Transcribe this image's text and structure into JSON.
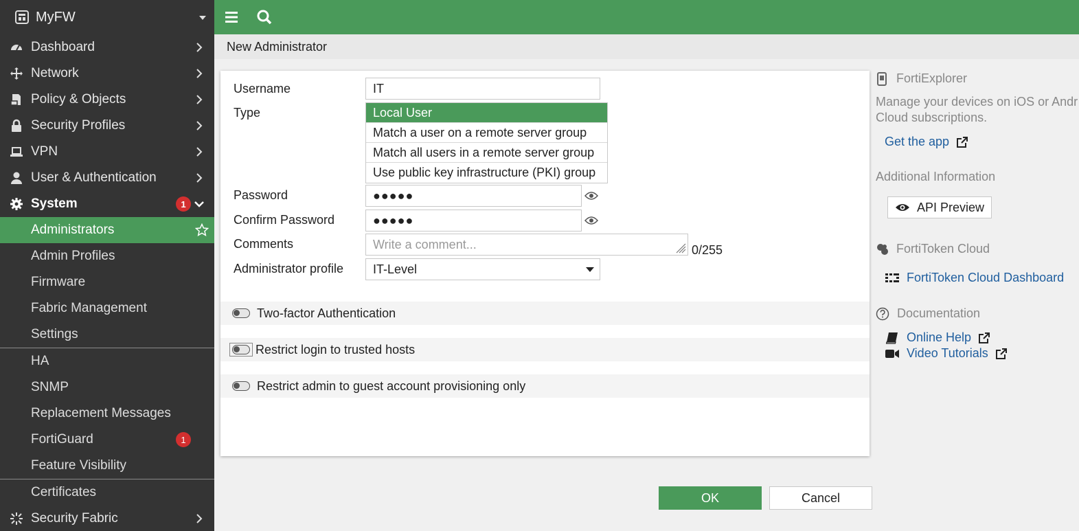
{
  "app": {
    "device_name": "MyFW"
  },
  "sidebar": {
    "items": [
      {
        "label": "Dashboard",
        "icon": "dashboard-icon"
      },
      {
        "label": "Network",
        "icon": "network-icon"
      },
      {
        "label": "Policy & Objects",
        "icon": "policy-icon"
      },
      {
        "label": "Security Profiles",
        "icon": "lock-icon"
      },
      {
        "label": "VPN",
        "icon": "laptop-icon"
      },
      {
        "label": "User & Authentication",
        "icon": "user-icon"
      },
      {
        "label": "System",
        "icon": "gear-icon",
        "badge": "1"
      }
    ],
    "system_sub": [
      {
        "label": "Administrators"
      },
      {
        "label": "Admin Profiles"
      },
      {
        "label": "Firmware"
      },
      {
        "label": "Fabric Management"
      },
      {
        "label": "Settings"
      },
      {
        "label": "HA"
      },
      {
        "label": "SNMP"
      },
      {
        "label": "Replacement Messages"
      },
      {
        "label": "FortiGuard",
        "badge": "1"
      },
      {
        "label": "Feature Visibility"
      },
      {
        "label": "Certificates"
      }
    ],
    "security_fabric": {
      "label": "Security Fabric",
      "icon": "fabric-icon"
    }
  },
  "page": {
    "title": "New Administrator"
  },
  "form": {
    "username_label": "Username",
    "username_value": "IT",
    "type_label": "Type",
    "type_options": [
      "Local User",
      "Match a user on a remote server group",
      "Match all users in a remote server group",
      "Use public key infrastructure (PKI) group"
    ],
    "password_label": "Password",
    "password_value": "●●●●●",
    "confirm_label": "Confirm Password",
    "confirm_value": "●●●●●",
    "comments_label": "Comments",
    "comments_placeholder": "Write a comment...",
    "comments_count": "0/255",
    "profile_label": "Administrator profile",
    "profile_value": "IT-Level",
    "two_factor": "Two-factor Authentication",
    "trusted_hosts": "Restrict login to trusted hosts",
    "guest_only": "Restrict admin to guest account provisioning only"
  },
  "info": {
    "fortiexplorer_title": "FortiExplorer",
    "fortiexplorer_text1": "Manage your devices on iOS or Andr",
    "fortiexplorer_text2": "Cloud subscriptions.",
    "get_app": "Get the app",
    "additional_title": "Additional Information",
    "api_preview": "API Preview",
    "fortitoken_title": "FortiToken Cloud",
    "fortitoken_dashboard": "FortiToken Cloud Dashboard",
    "documentation_title": "Documentation",
    "online_help": "Online Help",
    "video_tutorials": "Video Tutorials"
  },
  "buttons": {
    "ok": "OK",
    "cancel": "Cancel"
  },
  "colors": {
    "accent": "#4a9a5a",
    "sidebar": "#343434",
    "badge": "#d32f2f",
    "link": "#1f5e9e"
  }
}
